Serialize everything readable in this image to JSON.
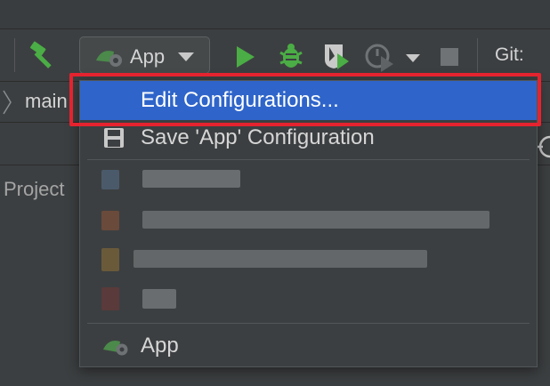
{
  "toolbar": {
    "run_config": {
      "label": "App"
    },
    "git_label": "Git:"
  },
  "navbar": {
    "breadcrumb": "main"
  },
  "tool_window": {
    "project_label": "Project"
  },
  "popup": {
    "items": [
      {
        "label": "Edit Configurations...",
        "selected": true,
        "icon": "none"
      },
      {
        "label": "Save 'App' Configuration",
        "icon": "save-icon"
      },
      {
        "label": "App",
        "icon": "android-app-icon"
      }
    ]
  },
  "colors": {
    "background": "#3c3f41",
    "selection": "#2f65ca",
    "highlight_border": "#e5232f",
    "run_green": "#4bad45"
  }
}
